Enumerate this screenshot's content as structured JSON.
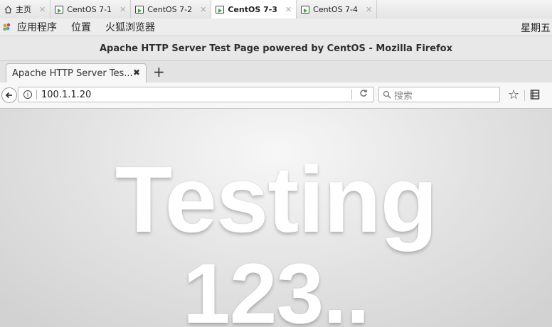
{
  "vm_tabs": [
    {
      "label": "主页",
      "icon": "home-icon",
      "active": false
    },
    {
      "label": "CentOS 7-1",
      "icon": "vm-icon",
      "active": false
    },
    {
      "label": "CentOS 7-2",
      "icon": "vm-icon",
      "active": false
    },
    {
      "label": "CentOS 7-3",
      "icon": "vm-icon",
      "active": true
    },
    {
      "label": "CentOS 7-4",
      "icon": "vm-icon",
      "active": false
    }
  ],
  "gnome_bar": {
    "applications": "应用程序",
    "places": "位置",
    "firefox": "火狐浏览器",
    "clock": "星期五"
  },
  "window": {
    "title": "Apache HTTP Server Test Page powered by CentOS - Mozilla Firefox"
  },
  "browser": {
    "tab_label": "Apache HTTP Server Tes...",
    "url": "100.1.1.20",
    "search_placeholder": "搜索"
  },
  "page": {
    "line1": "Testing",
    "line2": "123.."
  },
  "colors": {
    "active_vm_icon": "#3aa23a",
    "content_bg": "#e2e2e2"
  }
}
